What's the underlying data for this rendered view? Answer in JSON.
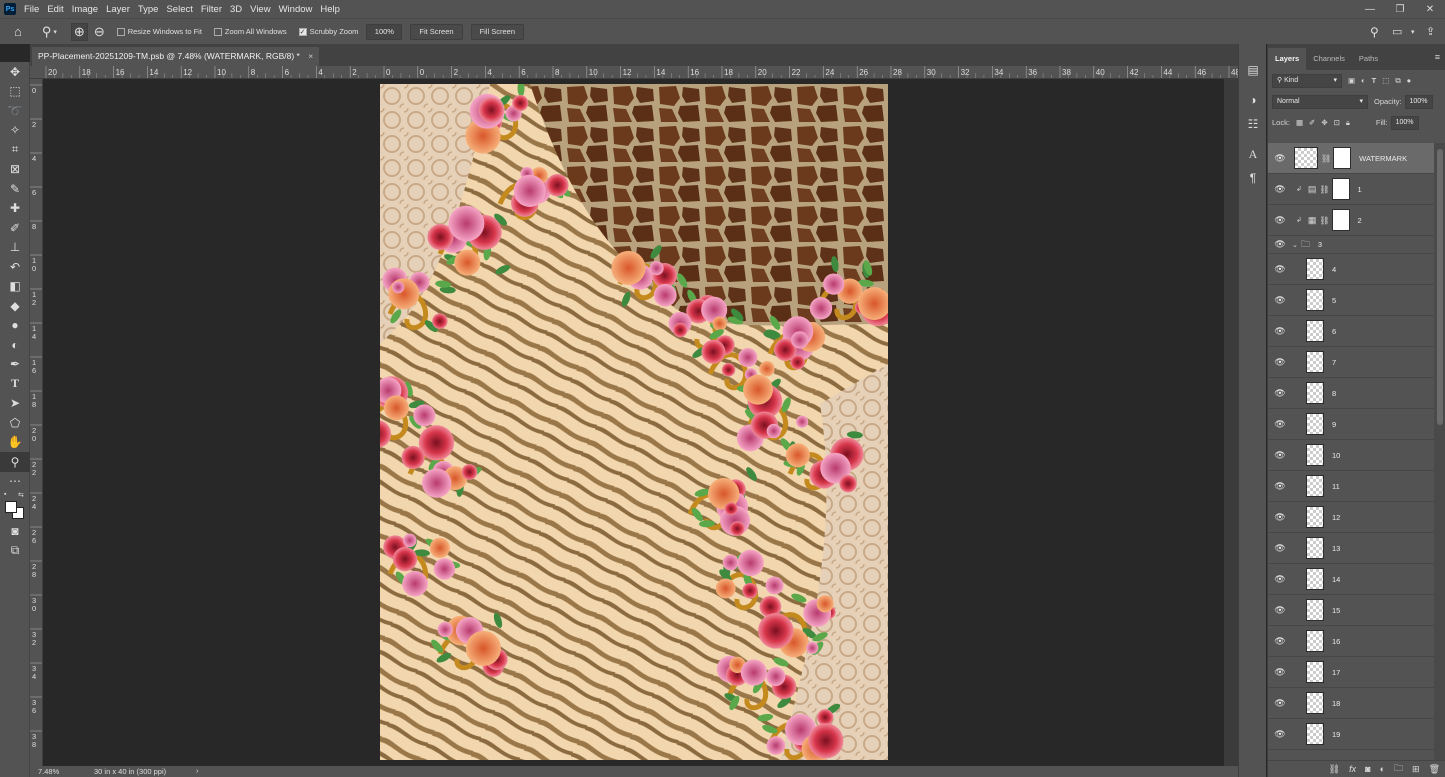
{
  "app": {
    "logo": "Ps"
  },
  "menu": [
    "File",
    "Edit",
    "Image",
    "Layer",
    "Type",
    "Select",
    "Filter",
    "3D",
    "View",
    "Window",
    "Help"
  ],
  "options": {
    "resize_windows": "Resize Windows to Fit",
    "zoom_all": "Zoom All Windows",
    "scrubby": "Scrubby Zoom",
    "zoom_value": "100%",
    "fit_screen": "Fit Screen",
    "fill_screen": "Fill Screen"
  },
  "document": {
    "tab_title": "PP-Placement-20251209-TM.psb @ 7.48% (WATERMARK, RGB/8) *",
    "close": "×"
  },
  "hruler_labels": [
    "20",
    "18",
    "16",
    "14",
    "12",
    "10",
    "8",
    "6",
    "4",
    "2",
    "0",
    "0",
    "2",
    "4",
    "6",
    "8",
    "10",
    "12",
    "14",
    "16",
    "18",
    "20",
    "22",
    "24",
    "26",
    "28",
    "30",
    "32",
    "34",
    "36",
    "38",
    "40",
    "42",
    "44",
    "46",
    "48"
  ],
  "vruler_labels": [
    "0",
    "2",
    "4",
    "6",
    "8",
    "10",
    "12",
    "14",
    "16",
    "18",
    "20",
    "22",
    "24",
    "26",
    "28",
    "30",
    "32",
    "34",
    "36",
    "38"
  ],
  "status": {
    "zoom": "7.48%",
    "doc_info": "30 in x 40 in (300 ppi)",
    "arrow": "›"
  },
  "panel": {
    "tabs": [
      "Layers",
      "Channels",
      "Paths"
    ],
    "kind": "Kind",
    "blend_mode": "Normal",
    "opacity_label": "Opacity:",
    "opacity_value": "100%",
    "lock_label": "Lock:",
    "fill_label": "Fill:",
    "fill_value": "100%"
  },
  "layers": [
    "WATERMARK",
    "1",
    "2",
    "3",
    "4",
    "5",
    "6",
    "7",
    "8",
    "9",
    "10",
    "11",
    "12",
    "13",
    "14",
    "15",
    "16",
    "17",
    "18",
    "19"
  ],
  "colors": {
    "ui_bg": "#535353",
    "canvas_bg": "#282828",
    "accent": "#31a8ff",
    "selected_layer": "#6a6a6a"
  }
}
